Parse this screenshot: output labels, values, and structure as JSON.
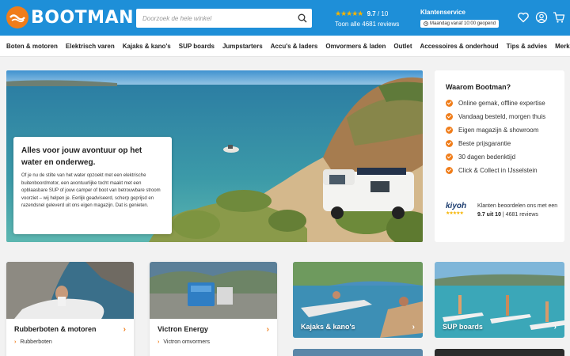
{
  "header": {
    "logo_text": "BOOTMAN",
    "search_placeholder": "Doorzoek de hele winkel",
    "rating_stars": "★★★★★",
    "rating_score": "9.7",
    "rating_max": "/ 10",
    "reviews_link": "Toon alle 4681 reviews",
    "service_title": "Klantenservice",
    "service_hours": "Maandag vanaf 10:00 geopend"
  },
  "nav": {
    "items": [
      "Boten & motoren",
      "Elektrisch varen",
      "Kajaks & kano's",
      "SUP boards",
      "Jumpstarters",
      "Accu's & laders",
      "Omvormers & laden",
      "Outlet",
      "Accessoires & onderhoud",
      "Tips & advies",
      "Merken"
    ]
  },
  "hero": {
    "title": "Alles voor jouw avontuur op het water en onderweg.",
    "body": "Of je nu de stilte van het water opzoekt met een elektrische buitenboordmotor, een avontuurlijke tocht maakt met een opblaasbare SUP of jouw camper of boot van betrouwbare stroom voorziet – wij helpen je. Eerlijk geadviseerd, scherp geprijsd en razendsnel geleverd uit ons eigen magazijn. Dat is genieten."
  },
  "why": {
    "title": "Waarom Bootman?",
    "items": [
      "Online gemak, offline expertise",
      "Vandaag besteld, morgen thuis",
      "Eigen magazijn & showroom",
      "Beste prijsgarantie",
      "30 dagen bedenktijd",
      "Click & Collect in IJsselstein"
    ],
    "kiyoh_word": "kiyoh",
    "kiyoh_stars": "★★★★★",
    "kiyoh_pre": "Klanten beoordelen ons met een",
    "kiyoh_score": "9.7 uit 10",
    "kiyoh_post": "| 4681 reviews"
  },
  "cards": [
    {
      "title": "Rubberboten & motoren",
      "sub": "Rubberboten"
    },
    {
      "title": "Victron Energy",
      "sub": "Victron omvormers"
    }
  ],
  "photo_cards": [
    {
      "label": "Kajaks & kano's"
    },
    {
      "label": "SUP boards"
    }
  ],
  "colors": {
    "header_blue": "#1e8fd8",
    "accent_orange": "#f07d1a",
    "star_yellow": "#f6b400"
  }
}
